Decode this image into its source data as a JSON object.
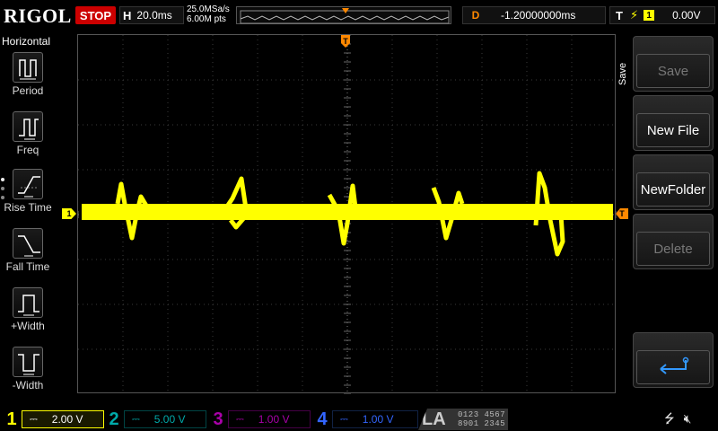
{
  "app": {
    "brand": "RIGOL"
  },
  "topbar": {
    "run_state": "STOP",
    "timebase_label": "H",
    "timebase_value": "20.0ms",
    "sample_rate": "25.0MSa/s",
    "memory_depth": "6.00M pts",
    "delay_label": "D",
    "delay_value": "-1.20000000ms",
    "trigger_label": "T",
    "trigger_channel": "1",
    "trigger_level": "0.00V"
  },
  "left_menu": {
    "title": "Horizontal",
    "items": [
      {
        "label": "Period",
        "icon": "period-icon"
      },
      {
        "label": "Freq",
        "icon": "freq-icon"
      },
      {
        "label": "Rise Time",
        "icon": "rise-time-icon"
      },
      {
        "label": "Fall Time",
        "icon": "fall-time-icon"
      },
      {
        "label": "+Width",
        "icon": "pos-width-icon"
      },
      {
        "label": "-Width",
        "icon": "neg-width-icon"
      }
    ]
  },
  "markers": {
    "trigger_top": "T",
    "ch1": "1",
    "trigger_level": "T"
  },
  "right_menu": {
    "tab_label": "Save",
    "buttons": [
      {
        "label": "Save",
        "enabled": false
      },
      {
        "label": "New File",
        "enabled": true
      },
      {
        "label": "NewFolder",
        "enabled": true
      },
      {
        "label": "Delete",
        "enabled": false
      },
      {
        "label": "",
        "icon": "return-icon",
        "enabled": true
      }
    ]
  },
  "channels": [
    {
      "num": "1",
      "scale": "2.00 V",
      "color": "#ffff00",
      "active": true
    },
    {
      "num": "2",
      "scale": "5.00 V",
      "color": "#00c8c8",
      "active": false
    },
    {
      "num": "3",
      "scale": "1.00 V",
      "color": "#c000c0",
      "active": false
    },
    {
      "num": "4",
      "scale": "1.00 V",
      "color": "#3060ff",
      "active": false
    }
  ],
  "la": {
    "label": "LA",
    "bits_row1": "0123 4567",
    "bits_row2": "8901 2345"
  },
  "colors": {
    "trace": "#ffff00",
    "trigger": "#ff8800",
    "grid": "#444444",
    "stop": "#cc0000"
  }
}
